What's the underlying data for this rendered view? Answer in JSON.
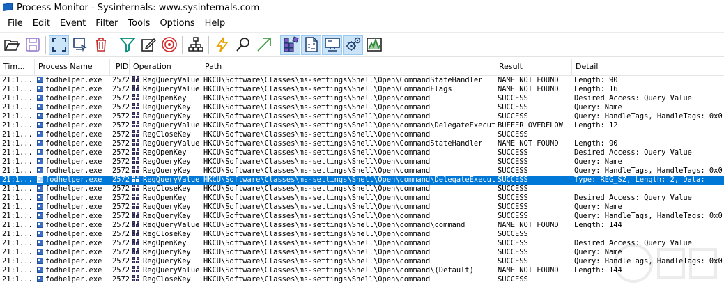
{
  "window": {
    "title": "Process Monitor - Sysinternals: www.sysinternals.com"
  },
  "menu": [
    "File",
    "Edit",
    "Event",
    "Filter",
    "Tools",
    "Options",
    "Help"
  ],
  "toolbar_icons": [
    "open-icon",
    "save-icon",
    "capture-icon",
    "autoscroll-icon",
    "clear-icon",
    "filter-icon",
    "highlight-icon",
    "include-process-icon",
    "process-tree-icon",
    "event-properties-icon",
    "find-icon",
    "jump-icon",
    "registry-activity-icon",
    "file-activity-icon",
    "network-activity-icon",
    "process-activity-icon",
    "profiling-activity-icon"
  ],
  "colors": {
    "selection": "#0078d7",
    "toolbar_active": "#cce4f7"
  },
  "columns": [
    "Tim...",
    "Process Name",
    "PID",
    "Operation",
    "Path",
    "Result",
    "Detail"
  ],
  "rows": [
    {
      "time": "21:1...",
      "process": "fodhelper.exe",
      "pid": "2572",
      "operation": "RegQueryValue",
      "path": "HKCU\\Software\\Classes\\ms-settings\\Shell\\Open\\CommandStateHandler",
      "result": "NAME NOT FOUND",
      "detail": "Length: 90"
    },
    {
      "time": "21:1...",
      "process": "fodhelper.exe",
      "pid": "2572",
      "operation": "RegQueryValue",
      "path": "HKCU\\Software\\Classes\\ms-settings\\Shell\\Open\\CommandFlags",
      "result": "NAME NOT FOUND",
      "detail": "Length: 16"
    },
    {
      "time": "21:1...",
      "process": "fodhelper.exe",
      "pid": "2572",
      "operation": "RegOpenKey",
      "path": "HKCU\\Software\\Classes\\ms-settings\\Shell\\Open\\command",
      "result": "SUCCESS",
      "detail": "Desired Access: Query Value"
    },
    {
      "time": "21:1...",
      "process": "fodhelper.exe",
      "pid": "2572",
      "operation": "RegQueryKey",
      "path": "HKCU\\Software\\Classes\\ms-settings\\Shell\\Open\\command",
      "result": "SUCCESS",
      "detail": "Query: Name"
    },
    {
      "time": "21:1...",
      "process": "fodhelper.exe",
      "pid": "2572",
      "operation": "RegQueryKey",
      "path": "HKCU\\Software\\Classes\\ms-settings\\Shell\\Open\\command",
      "result": "SUCCESS",
      "detail": "Query: HandleTags, HandleTags: 0x0"
    },
    {
      "time": "21:1...",
      "process": "fodhelper.exe",
      "pid": "2572",
      "operation": "RegQueryValue",
      "path": "HKCU\\Software\\Classes\\ms-settings\\Shell\\Open\\command\\DelegateExecute",
      "result": "BUFFER OVERFLOW",
      "detail": "Length: 12"
    },
    {
      "time": "21:1...",
      "process": "fodhelper.exe",
      "pid": "2572",
      "operation": "RegCloseKey",
      "path": "HKCU\\Software\\Classes\\ms-settings\\Shell\\Open\\command",
      "result": "SUCCESS",
      "detail": ""
    },
    {
      "time": "21:1...",
      "process": "fodhelper.exe",
      "pid": "2572",
      "operation": "RegQueryValue",
      "path": "HKCU\\Software\\Classes\\ms-settings\\Shell\\Open\\CommandStateHandler",
      "result": "NAME NOT FOUND",
      "detail": "Length: 90"
    },
    {
      "time": "21:1...",
      "process": "fodhelper.exe",
      "pid": "2572",
      "operation": "RegOpenKey",
      "path": "HKCU\\Software\\Classes\\ms-settings\\Shell\\Open\\command",
      "result": "SUCCESS",
      "detail": "Desired Access: Query Value"
    },
    {
      "time": "21:1...",
      "process": "fodhelper.exe",
      "pid": "2572",
      "operation": "RegQueryKey",
      "path": "HKCU\\Software\\Classes\\ms-settings\\Shell\\Open\\command",
      "result": "SUCCESS",
      "detail": "Query: Name"
    },
    {
      "time": "21:1...",
      "process": "fodhelper.exe",
      "pid": "2572",
      "operation": "RegQueryKey",
      "path": "HKCU\\Software\\Classes\\ms-settings\\Shell\\Open\\command",
      "result": "SUCCESS",
      "detail": "Query: HandleTags, HandleTags: 0x0"
    },
    {
      "time": "21:1...",
      "process": "fodhelper.exe",
      "pid": "2572",
      "operation": "RegQueryValue",
      "path": "HKCU\\Software\\Classes\\ms-settings\\Shell\\Open\\command\\DelegateExecute",
      "result": "SUCCESS",
      "detail": "Type: REG_SZ, Length: 2, Data:",
      "selected": true
    },
    {
      "time": "21:1...",
      "process": "fodhelper.exe",
      "pid": "2572",
      "operation": "RegCloseKey",
      "path": "HKCU\\Software\\Classes\\ms-settings\\Shell\\Open\\command",
      "result": "SUCCESS",
      "detail": ""
    },
    {
      "time": "21:1...",
      "process": "fodhelper.exe",
      "pid": "2572",
      "operation": "RegOpenKey",
      "path": "HKCU\\Software\\Classes\\ms-settings\\Shell\\Open\\command",
      "result": "SUCCESS",
      "detail": "Desired Access: Query Value"
    },
    {
      "time": "21:1...",
      "process": "fodhelper.exe",
      "pid": "2572",
      "operation": "RegQueryKey",
      "path": "HKCU\\Software\\Classes\\ms-settings\\Shell\\Open\\command",
      "result": "SUCCESS",
      "detail": "Query: Name"
    },
    {
      "time": "21:1...",
      "process": "fodhelper.exe",
      "pid": "2572",
      "operation": "RegQueryKey",
      "path": "HKCU\\Software\\Classes\\ms-settings\\Shell\\Open\\command",
      "result": "SUCCESS",
      "detail": "Query: HandleTags, HandleTags: 0x0"
    },
    {
      "time": "21:1...",
      "process": "fodhelper.exe",
      "pid": "2572",
      "operation": "RegQueryValue",
      "path": "HKCU\\Software\\Classes\\ms-settings\\Shell\\Open\\command\\command",
      "result": "NAME NOT FOUND",
      "detail": "Length: 144"
    },
    {
      "time": "21:1...",
      "process": "fodhelper.exe",
      "pid": "2572",
      "operation": "RegCloseKey",
      "path": "HKCU\\Software\\Classes\\ms-settings\\Shell\\Open\\command",
      "result": "SUCCESS",
      "detail": ""
    },
    {
      "time": "21:1...",
      "process": "fodhelper.exe",
      "pid": "2572",
      "operation": "RegOpenKey",
      "path": "HKCU\\Software\\Classes\\ms-settings\\Shell\\Open\\command",
      "result": "SUCCESS",
      "detail": "Desired Access: Query Value"
    },
    {
      "time": "21:1...",
      "process": "fodhelper.exe",
      "pid": "2572",
      "operation": "RegQueryKey",
      "path": "HKCU\\Software\\Classes\\ms-settings\\Shell\\Open\\command",
      "result": "SUCCESS",
      "detail": "Query: Name"
    },
    {
      "time": "21:1...",
      "process": "fodhelper.exe",
      "pid": "2572",
      "operation": "RegQueryKey",
      "path": "HKCU\\Software\\Classes\\ms-settings\\Shell\\Open\\command",
      "result": "SUCCESS",
      "detail": "Query: HandleTags, HandleTags: 0x0"
    },
    {
      "time": "21:1...",
      "process": "fodhelper.exe",
      "pid": "2572",
      "operation": "RegQueryValue",
      "path": "HKCU\\Software\\Classes\\ms-settings\\Shell\\Open\\command\\(Default)",
      "result": "NAME NOT FOUND",
      "detail": "Length: 144"
    },
    {
      "time": "21:1...",
      "process": "fodhelper.exe",
      "pid": "2572",
      "operation": "RegCloseKey",
      "path": "HKCU\\Software\\Classes\\ms-settings\\Shell\\Open\\command",
      "result": "SUCCESS",
      "detail": ""
    }
  ]
}
